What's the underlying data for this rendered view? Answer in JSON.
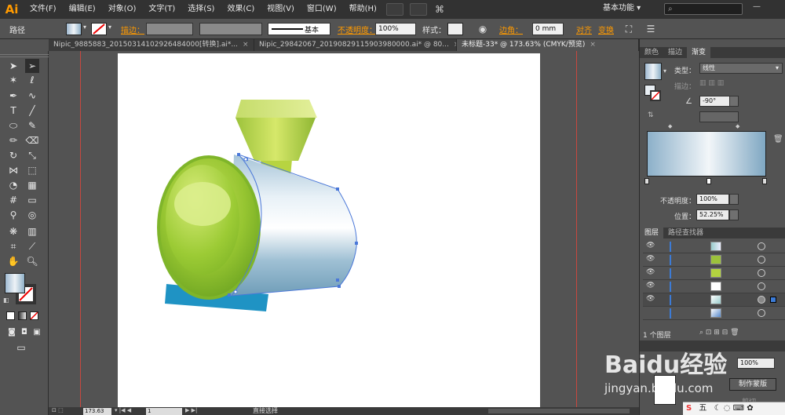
{
  "app": {
    "logo": "Ai"
  },
  "menu": [
    "文件(F)",
    "编辑(E)",
    "对象(O)",
    "文字(T)",
    "选择(S)",
    "效果(C)",
    "视图(V)",
    "窗口(W)",
    "帮助(H)"
  ],
  "workspace": "基本功能",
  "control_bar": {
    "object_type": "路径",
    "stroke_label": "描边：",
    "brush_label": "基本",
    "opacity_label": "不透明度：",
    "opacity_value": "100%",
    "style_label": "样式：",
    "corner_label": "边角：",
    "corner_value": "0 mm",
    "align_label": "对齐",
    "transform_label": "变换"
  },
  "doc_tabs": [
    {
      "title": "Nipic_9885883_20150314102926484000[转换].ai*..."
    },
    {
      "title": "Nipic_29842067_20190829115903980000.ai* @ 80..."
    },
    {
      "title": "未标题-33* @ 173.63% (CMYK/预览)"
    }
  ],
  "status": {
    "zoom": "173.63",
    "page": "1",
    "tool": "直接选择"
  },
  "panels": {
    "top_tabs": [
      "颜色",
      "描边",
      "渐变"
    ],
    "gradient": {
      "type_label": "类型：",
      "type_value": "线性",
      "stroke_label": "描边：",
      "angle_value": "-90°",
      "opacity_label": "不透明度：",
      "opacity_value": "100%",
      "location_label": "位置：",
      "location_value": "52.25%"
    },
    "layer_tabs": [
      "图层",
      "路径查找器"
    ],
    "layers_footer": "1 个图层",
    "transparency_value": "100%",
    "make_mask": "制作蒙版",
    "clip": "剪切"
  },
  "watermark": {
    "brand": "Baidu经验",
    "url": "jingyan.baidu.com"
  },
  "ime": {
    "label": "五"
  }
}
